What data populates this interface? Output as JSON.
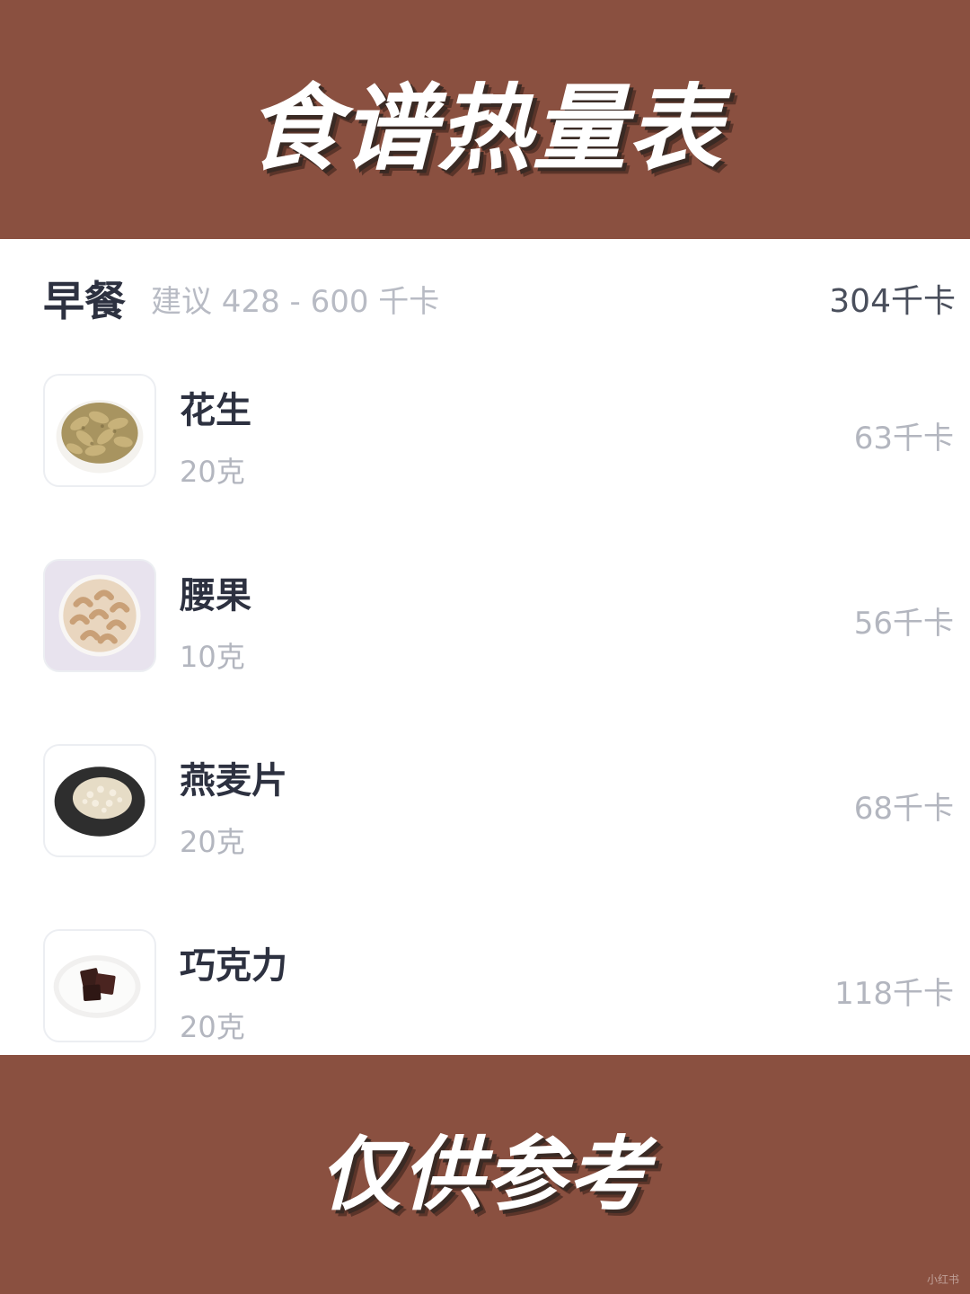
{
  "banner": {
    "top_text": "食谱热量表",
    "bottom_text": "仅供参考",
    "watermark": "小红书"
  },
  "meal": {
    "title": "早餐",
    "suggestion": "建议 428 - 600 千卡",
    "total": "304千卡"
  },
  "foods": [
    {
      "name": "花生",
      "amount": "20克",
      "calories": "63千卡",
      "icon": "peanut-image"
    },
    {
      "name": "腰果",
      "amount": "10克",
      "calories": "56千卡",
      "icon": "cashew-image"
    },
    {
      "name": "燕麦片",
      "amount": "20克",
      "calories": "68千卡",
      "icon": "oatmeal-image"
    },
    {
      "name": "巧克力",
      "amount": "20克",
      "calories": "118千卡",
      "icon": "chocolate-image"
    }
  ],
  "colors": {
    "banner_bg": "#8a5040",
    "text_dark": "#2d3140",
    "text_muted": "#b3b6bf"
  }
}
